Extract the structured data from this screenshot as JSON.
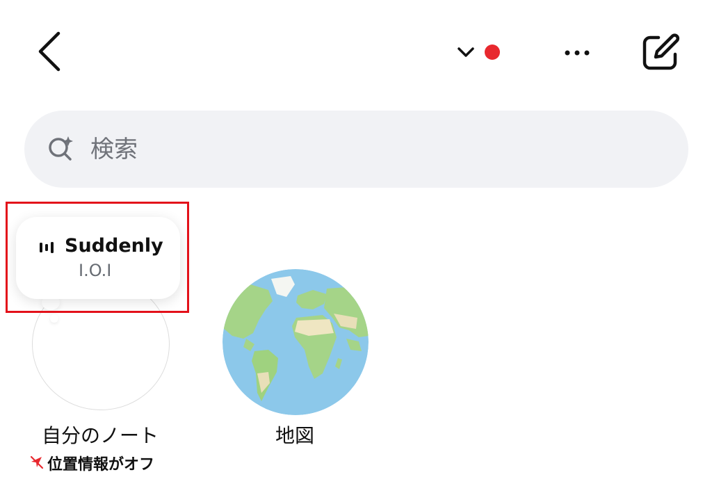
{
  "search": {
    "placeholder": "検索"
  },
  "note": {
    "song_title": "Suddenly",
    "artist": "I.O.I"
  },
  "profile": {
    "own_label": "自分のノート",
    "location_status": "位置情報がオフ"
  },
  "map": {
    "label": "地図"
  },
  "colors": {
    "notification_dot": "#e8282e",
    "highlight": "#e3111a",
    "search_bg": "#f1f2f5"
  },
  "icons": [
    "back-icon",
    "chevron-down-icon",
    "more-icon",
    "compose-icon",
    "search-sparkle-icon",
    "music-bars-icon",
    "location-off-icon"
  ]
}
